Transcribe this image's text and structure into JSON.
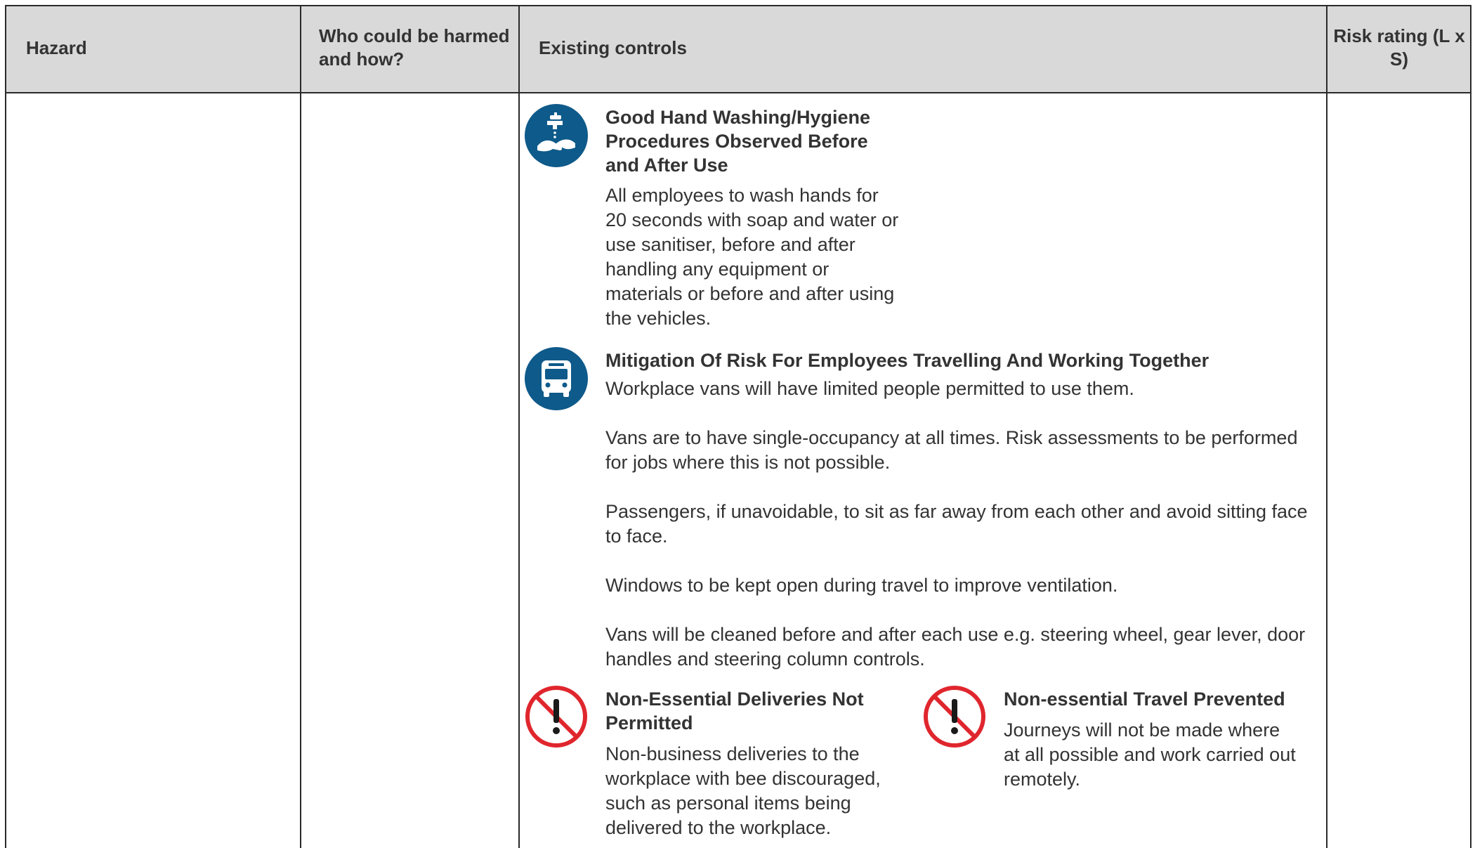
{
  "header": {
    "hazard": "Hazard",
    "who": "Who could be harmed and how?",
    "controls": "Existing controls",
    "risk": "Risk rating (L x S)"
  },
  "controls": {
    "hand_washing": {
      "icon": "hand-washing-icon",
      "title": "Good Hand Washing/Hygiene Procedures Observed Before and After Use",
      "body": "All employees to wash hands for 20 seconds with soap and water or use sanitiser, before and after handling any equipment or materials or before and after using the vehicles."
    },
    "travelling": {
      "icon": "van-icon",
      "title": "Mitigation Of Risk For Employees Travelling And Working Together",
      "paragraphs": [
        "Workplace vans will have limited people permitted to use them.",
        "Vans are to have single-occupancy at all times. Risk assessments to be performed for jobs where this is not possible.",
        "Passengers, if unavoidable, to sit as far away from each other and avoid sitting face to face.",
        "Windows to be kept open during travel to improve ventilation.",
        "Vans will be cleaned before and after each use e.g. steering wheel, gear lever, door handles and steering column controls."
      ]
    },
    "deliveries": {
      "icon": "prohibited-exclamation-icon",
      "title": "Non-Essential Deliveries Not Permitted",
      "body": "Non-business deliveries to the workplace with bee discouraged, such as personal items being delivered to the workplace."
    },
    "travel": {
      "icon": "prohibited-exclamation-icon",
      "title": "Non-essential Travel Prevented",
      "body": "Journeys will not be made where at all possible and work carried out remotely."
    }
  },
  "colors": {
    "header_bg": "#d9d9d9",
    "icon_blue": "#0e5a8a",
    "prohibit_red": "#e0262d",
    "border": "#2a2a2a",
    "text": "#333333"
  }
}
